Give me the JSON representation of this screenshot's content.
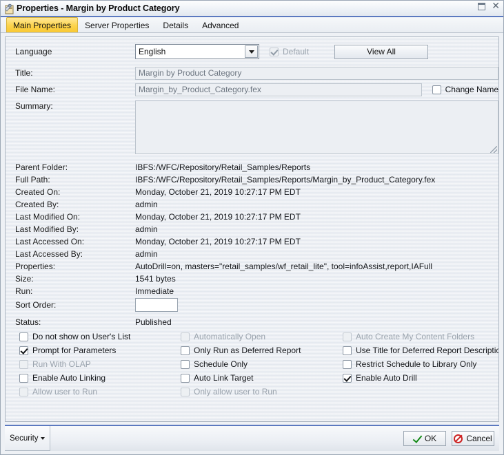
{
  "window": {
    "title": "Properties - Margin by Product Category",
    "icon": "properties-tool-icon",
    "maximize_label": "Maximize",
    "close_label": "Close"
  },
  "tabs": [
    {
      "label": "Main Properties",
      "active": true
    },
    {
      "label": "Server Properties",
      "active": false
    },
    {
      "label": "Details",
      "active": false
    },
    {
      "label": "Advanced",
      "active": false
    }
  ],
  "form": {
    "language": {
      "label": "Language",
      "value": "English",
      "options": [
        "English"
      ]
    },
    "default_checkbox": {
      "label": "Default",
      "checked": true,
      "disabled": true
    },
    "view_all_button": {
      "label": "View All"
    },
    "title": {
      "label": "Title:",
      "value": "Margin by Product Category"
    },
    "file_name": {
      "label": "File Name:",
      "value": "Margin_by_Product_Category.fex"
    },
    "change_name": {
      "label": "Change Name",
      "checked": false,
      "disabled": false
    },
    "summary": {
      "label": "Summary:",
      "value": "",
      "placeholder": ""
    }
  },
  "info_rows": [
    {
      "label": "Parent Folder:",
      "value": "IBFS:/WFC/Repository/Retail_Samples/Reports"
    },
    {
      "label": "Full Path:",
      "value": "IBFS:/WFC/Repository/Retail_Samples/Reports/Margin_by_Product_Category.fex"
    },
    {
      "label": "Created On:",
      "value": "Monday, October 21, 2019 10:27:17 PM EDT"
    },
    {
      "label": "Created By:",
      "value": "admin"
    },
    {
      "label": "Last Modified On:",
      "value": "Monday, October 21, 2019 10:27:17 PM EDT"
    },
    {
      "label": "Last Modified By:",
      "value": "admin"
    },
    {
      "label": "Last Accessed On:",
      "value": "Monday, October 21, 2019 10:27:17 PM EDT"
    },
    {
      "label": "Last Accessed By:",
      "value": "admin"
    },
    {
      "label": "Properties:",
      "value": "AutoDrill=on, masters=\"retail_samples/wf_retail_lite\", tool=infoAssist,report,IAFull"
    },
    {
      "label": "Size:",
      "value": "1541 bytes"
    },
    {
      "label": "Run:",
      "value": "Immediate"
    }
  ],
  "sort_order": {
    "label": "Sort Order:",
    "value": ""
  },
  "status": {
    "label": "Status:",
    "value": "Published"
  },
  "options": {
    "column1": [
      {
        "label": "Do not show on User's List",
        "checked": false,
        "disabled": false
      },
      {
        "label": "Prompt for Parameters",
        "checked": true,
        "disabled": false
      },
      {
        "label": "Run With OLAP",
        "checked": false,
        "disabled": true
      },
      {
        "label": "Enable Auto Linking",
        "checked": false,
        "disabled": false
      },
      {
        "label": "Allow user to Run",
        "checked": false,
        "disabled": true
      }
    ],
    "column2": [
      {
        "label": "Automatically Open",
        "checked": false,
        "disabled": true
      },
      {
        "label": "Only Run as Deferred Report",
        "checked": false,
        "disabled": false
      },
      {
        "label": "Schedule Only",
        "checked": false,
        "disabled": false
      },
      {
        "label": "Auto Link Target",
        "checked": false,
        "disabled": false
      },
      {
        "label": "Only allow user to Run",
        "checked": false,
        "disabled": true
      }
    ],
    "column3": [
      {
        "label": "Auto Create My Content Folders",
        "checked": false,
        "disabled": true
      },
      {
        "label": "Use Title for Deferred Report Description",
        "checked": false,
        "disabled": false
      },
      {
        "label": "Restrict Schedule to Library Only",
        "checked": false,
        "disabled": false
      },
      {
        "label": "Enable Auto Drill",
        "checked": true,
        "disabled": false
      }
    ]
  },
  "footer": {
    "security_label": "Security",
    "ok_label": "OK",
    "cancel_label": "Cancel"
  },
  "colors": {
    "active_tab": "#fcd34a",
    "accent_border": "#5b79c0",
    "panel_bg": "#e8ecf1",
    "ok_icon": "#138a16",
    "cancel_icon": "#cc2222"
  }
}
